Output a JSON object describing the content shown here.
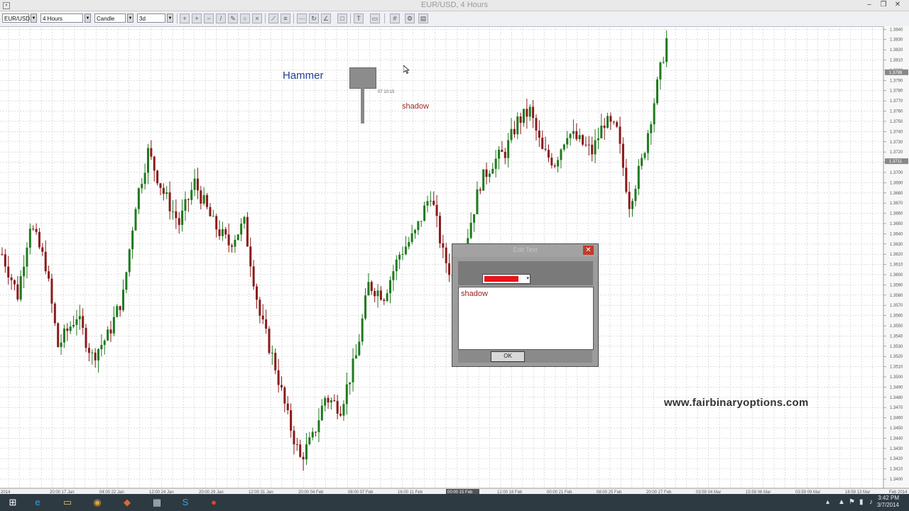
{
  "window": {
    "title": "EUR/USD, 4 Hours",
    "minimize": "–",
    "restore": "❐",
    "close": "✕"
  },
  "toolbar": {
    "symbol": "EUR/USD",
    "timeframe": "4 Hours",
    "chart_type": "Candle",
    "period": "3d"
  },
  "chart_data": {
    "type": "candlestick",
    "title": "EUR/USD, 4 Hours",
    "ylim": [
      1.3391,
      1.3843
    ],
    "price_ticks": [
      1.384,
      1.383,
      1.382,
      1.381,
      1.38,
      1.379,
      1.378,
      1.377,
      1.376,
      1.375,
      1.374,
      1.373,
      1.372,
      1.371,
      1.37,
      1.369,
      1.368,
      1.367,
      1.366,
      1.365,
      1.364,
      1.363,
      1.362,
      1.361,
      1.36,
      1.359,
      1.358,
      1.357,
      1.356,
      1.355,
      1.354,
      1.353,
      1.352,
      1.351,
      1.35,
      1.349,
      1.348,
      1.347,
      1.346,
      1.345,
      1.344,
      1.343,
      1.342,
      1.341,
      1.34
    ],
    "price_tick_labels": [
      "1.3840",
      "1.3830",
      "1.3820",
      "1.3810",
      "1.3800",
      "1.3790",
      "1.3780",
      "1.3770",
      "1.3760",
      "1.3750",
      "1.3740",
      "1.3730",
      "1.3720",
      "1.3710",
      "1.3700",
      "1.3690",
      "1.3680",
      "1.3670",
      "1.3660",
      "1.3650",
      "1.3640",
      "1.3630",
      "1.3620",
      "1.3610",
      "1.3600",
      "1.3590",
      "1.3580",
      "1.3570",
      "1.3560",
      "1.3550",
      "1.3540",
      "1.3530",
      "1.3520",
      "1.3510",
      "1.3500",
      "1.3490",
      "1.3480",
      "1.3470",
      "1.3460",
      "1.3450",
      "1.3440",
      "1.3430",
      "1.3420",
      "1.3410",
      "1.3400"
    ],
    "price_markers": [
      {
        "value": 1.3798,
        "label": "1.3798"
      },
      {
        "value": 1.3711,
        "label": "1.3711"
      }
    ],
    "x_labels": [
      "2014",
      "20:00 17 Jan",
      "04:00 22 Jan",
      "12:00 24 Jan",
      "20:00 29 Jan",
      "12:00 31 Jan",
      "20:00 04 Feb",
      "08:00 07 Feb",
      "16:00 11 Feb",
      "00:00 15 Feb",
      "12:00 18 Feb",
      "00:00 21 Feb",
      "08:00 25 Feb",
      "20:00 27 Feb",
      "03:59 04 Mar",
      "15:59 06 Mar",
      "03:59 09 Mar",
      "16:59 13 Mar",
      "Feb 2014"
    ],
    "up_color": "#1f7a1f",
    "down_color": "#8b1a1a",
    "grid": true,
    "legend": "none",
    "anchors": [
      [
        0,
        1.362
      ],
      [
        5,
        1.358
      ],
      [
        9,
        1.365
      ],
      [
        14,
        1.361
      ],
      [
        18,
        1.353
      ],
      [
        24,
        1.356
      ],
      [
        29,
        1.352
      ],
      [
        34,
        1.354
      ],
      [
        39,
        1.358
      ],
      [
        43,
        1.367
      ],
      [
        47,
        1.372
      ],
      [
        52,
        1.368
      ],
      [
        57,
        1.365
      ],
      [
        62,
        1.369
      ],
      [
        68,
        1.365
      ],
      [
        73,
        1.363
      ],
      [
        78,
        1.365
      ],
      [
        83,
        1.356
      ],
      [
        88,
        1.351
      ],
      [
        92,
        1.346
      ],
      [
        96,
        1.342
      ],
      [
        100,
        1.344
      ],
      [
        104,
        1.348
      ],
      [
        109,
        1.347
      ],
      [
        114,
        1.352
      ],
      [
        118,
        1.359
      ],
      [
        123,
        1.358
      ],
      [
        128,
        1.362
      ],
      [
        133,
        1.364
      ],
      [
        138,
        1.368
      ],
      [
        142,
        1.362
      ],
      [
        146,
        1.359
      ],
      [
        150,
        1.364
      ],
      [
        154,
        1.369
      ],
      [
        158,
        1.371
      ],
      [
        162,
        1.372
      ],
      [
        166,
        1.375
      ],
      [
        170,
        1.376
      ],
      [
        174,
        1.372
      ],
      [
        178,
        1.371
      ],
      [
        182,
        1.374
      ],
      [
        186,
        1.373
      ],
      [
        190,
        1.372
      ],
      [
        194,
        1.375
      ],
      [
        198,
        1.374
      ],
      [
        202,
        1.367
      ],
      [
        206,
        1.371
      ],
      [
        210,
        1.377
      ],
      [
        214,
        1.383
      ]
    ]
  },
  "annotations": {
    "hammer_label": "Hammer",
    "shadow_label": "shadow",
    "hammer_time": "07 10:15"
  },
  "dialog": {
    "title": "Edit Text",
    "close": "✕",
    "text_value": "shadow",
    "ok_label": "OK"
  },
  "watermark": "www.fairbinaryoptions.com",
  "taskbar": {
    "start_icon": "⊞",
    "icons": [
      "ie-icon",
      "file-explorer-icon",
      "chrome-icon",
      "app-icon",
      "calculator-icon",
      "skype-icon",
      "browser-icon"
    ],
    "clock_time": "3:42 PM",
    "clock_date": "3/7/2014"
  }
}
